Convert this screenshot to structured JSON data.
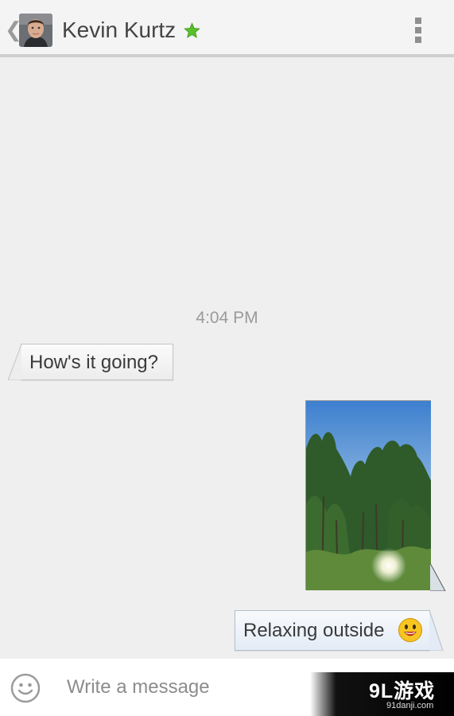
{
  "header": {
    "back_icon": "chevron-left-icon",
    "back_glyph": "❮",
    "avatar_icon": "contact-avatar",
    "contact_name": "Kevin Kurtz",
    "favorite_icon": "star-icon",
    "favorite_color": "#5bbf2a",
    "menu_icon": "overflow-menu-icon"
  },
  "conversation": {
    "timestamp": "4:04 PM",
    "messages": [
      {
        "direction": "incoming",
        "type": "text",
        "text": "How's it going?"
      },
      {
        "direction": "outgoing",
        "type": "image",
        "image_icon": "photo-trees-sun"
      },
      {
        "direction": "outgoing",
        "type": "text",
        "text": "Relaxing outside",
        "emoji_icon": "smiley-emoji-icon"
      }
    ]
  },
  "composer": {
    "emoji_button_icon": "smiley-icon",
    "placeholder": "Write a message",
    "value": ""
  },
  "watermark": {
    "brand": "9L游戏",
    "url": "91danji.com"
  },
  "colors": {
    "background": "#efefef",
    "header_border": "#cfcfcf",
    "outgoing_bubble": "#e3ecf6",
    "incoming_bubble": "#f4f4f4"
  }
}
